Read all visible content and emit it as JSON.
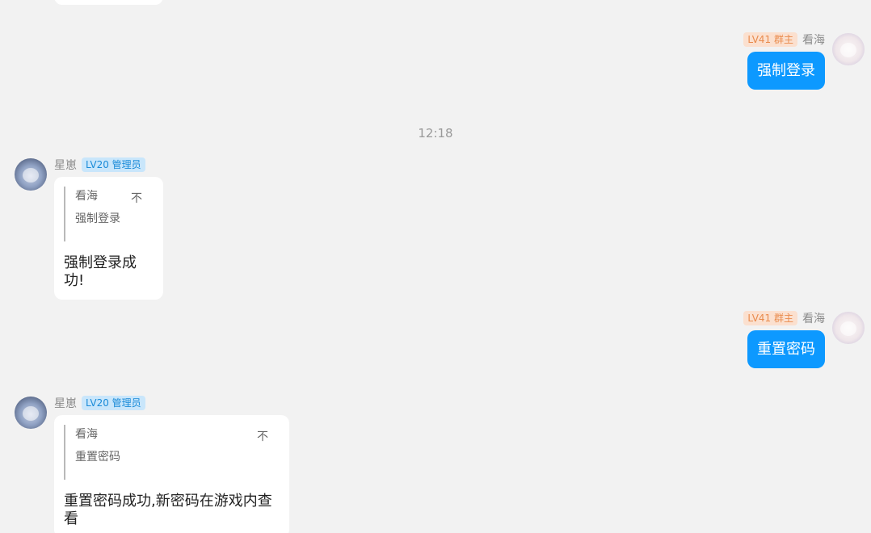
{
  "timestamp": "12:18",
  "messages": [
    {
      "side": "right",
      "name": "看海",
      "badge": "LV41 群主",
      "text": "强制登录"
    },
    {
      "side": "left",
      "name": "星崽",
      "badge": "LV20 管理员",
      "quote_author": "看海",
      "quote_mark": "不",
      "quote_text": "强制登录",
      "text": "强制登录成功!"
    },
    {
      "side": "right",
      "name": "看海",
      "badge": "LV41 群主",
      "text": "重置密码"
    },
    {
      "side": "left",
      "name": "星崽",
      "badge": "LV20 管理员",
      "quote_author": "看海",
      "quote_mark": "不",
      "quote_text": "重置密码",
      "text": "重置密码成功,新密码在游戏内查看"
    }
  ],
  "colors": {
    "background": "#f2f2f2",
    "self_bubble": "#0d99ff",
    "admin_badge_bg": "#c9e6fb",
    "admin_badge_text": "#1a8bd8",
    "owner_badge_bg": "#fbe0cf",
    "owner_badge_text": "#e98b4d"
  }
}
